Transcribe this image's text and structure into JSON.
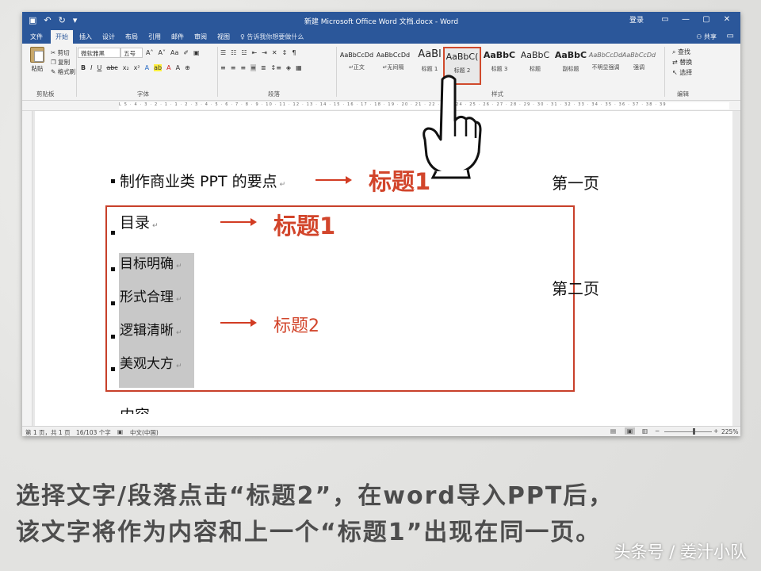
{
  "window": {
    "title": "新建 Microsoft Office Word 文档.docx - Word",
    "login": "登录",
    "tabs": [
      "文件",
      "开始",
      "插入",
      "设计",
      "布局",
      "引用",
      "邮件",
      "审阅",
      "视图"
    ],
    "tell_me": "告诉我你想要做什么",
    "share": "共享"
  },
  "ribbon": {
    "clipboard": {
      "paste": "粘贴",
      "cut": "剪切",
      "copy": "复制",
      "format_painter": "格式刷",
      "label": "剪贴板"
    },
    "font": {
      "name": "微软雅黑",
      "size": "五号",
      "label": "字体"
    },
    "paragraph": {
      "label": "段落"
    },
    "styles": {
      "label": "样式",
      "items": [
        {
          "preview": "AaBbCcDd",
          "name": "↵正文"
        },
        {
          "preview": "AaBbCcDd",
          "name": "↵无间隔"
        },
        {
          "preview": "AaBl",
          "name": "标题 1"
        },
        {
          "preview": "AaBbC(",
          "name": "标题 2"
        },
        {
          "preview": "AaBbC",
          "name": "标题 3"
        },
        {
          "preview": "AaBbC",
          "name": "标题"
        },
        {
          "preview": "AaBbC",
          "name": "副标题"
        },
        {
          "preview": "AaBbCcDd",
          "name": "不明显强调"
        },
        {
          "preview": "AaBbCcDd",
          "name": "强调"
        }
      ],
      "selected_index": 3
    },
    "editing": {
      "find": "查找",
      "replace": "替换",
      "select": "选择",
      "label": "编辑"
    }
  },
  "ruler": {
    "marks": "L  5 · 4 · 3 · 2 · 1 · 1 · 2 · 3 · 4 · 5 · 6 · 7 · 8 · 9 · 10 · 11 · 12 · 13 · 14 · 15 · 16 · 17 · 18 · 19 · 20 · 21 · 22 · 23 · 24 · 25 · 26 · 27 · 28 · 29 · 30 · 31 · 32 · 33 · 34 · 35 · 36 · 37 · 38 · 39"
  },
  "document": {
    "line1": "制作商业类 PPT 的要点",
    "toc": "目录",
    "items": [
      "目标明确",
      "形式合理",
      "逻辑清晰",
      "美观大方"
    ],
    "content": "内容"
  },
  "annotations": {
    "heading1_a": "标题1",
    "heading1_b": "标题1",
    "heading2": "标题2",
    "page1": "第一页",
    "page2": "第二页",
    "accent_color": "#d2452b"
  },
  "statusbar": {
    "page": "第 1 页，共 1 页",
    "words": "16/103 个字",
    "lang": "中文(中国)",
    "zoom": "225%"
  },
  "caption": {
    "line1": "选择文字/段落点击“标题2”，在word导入PPT后，",
    "line2": "该文字将作为内容和上一个“标题1”出现在同一页。"
  },
  "watermark": "头条号 / 姜汁小队"
}
